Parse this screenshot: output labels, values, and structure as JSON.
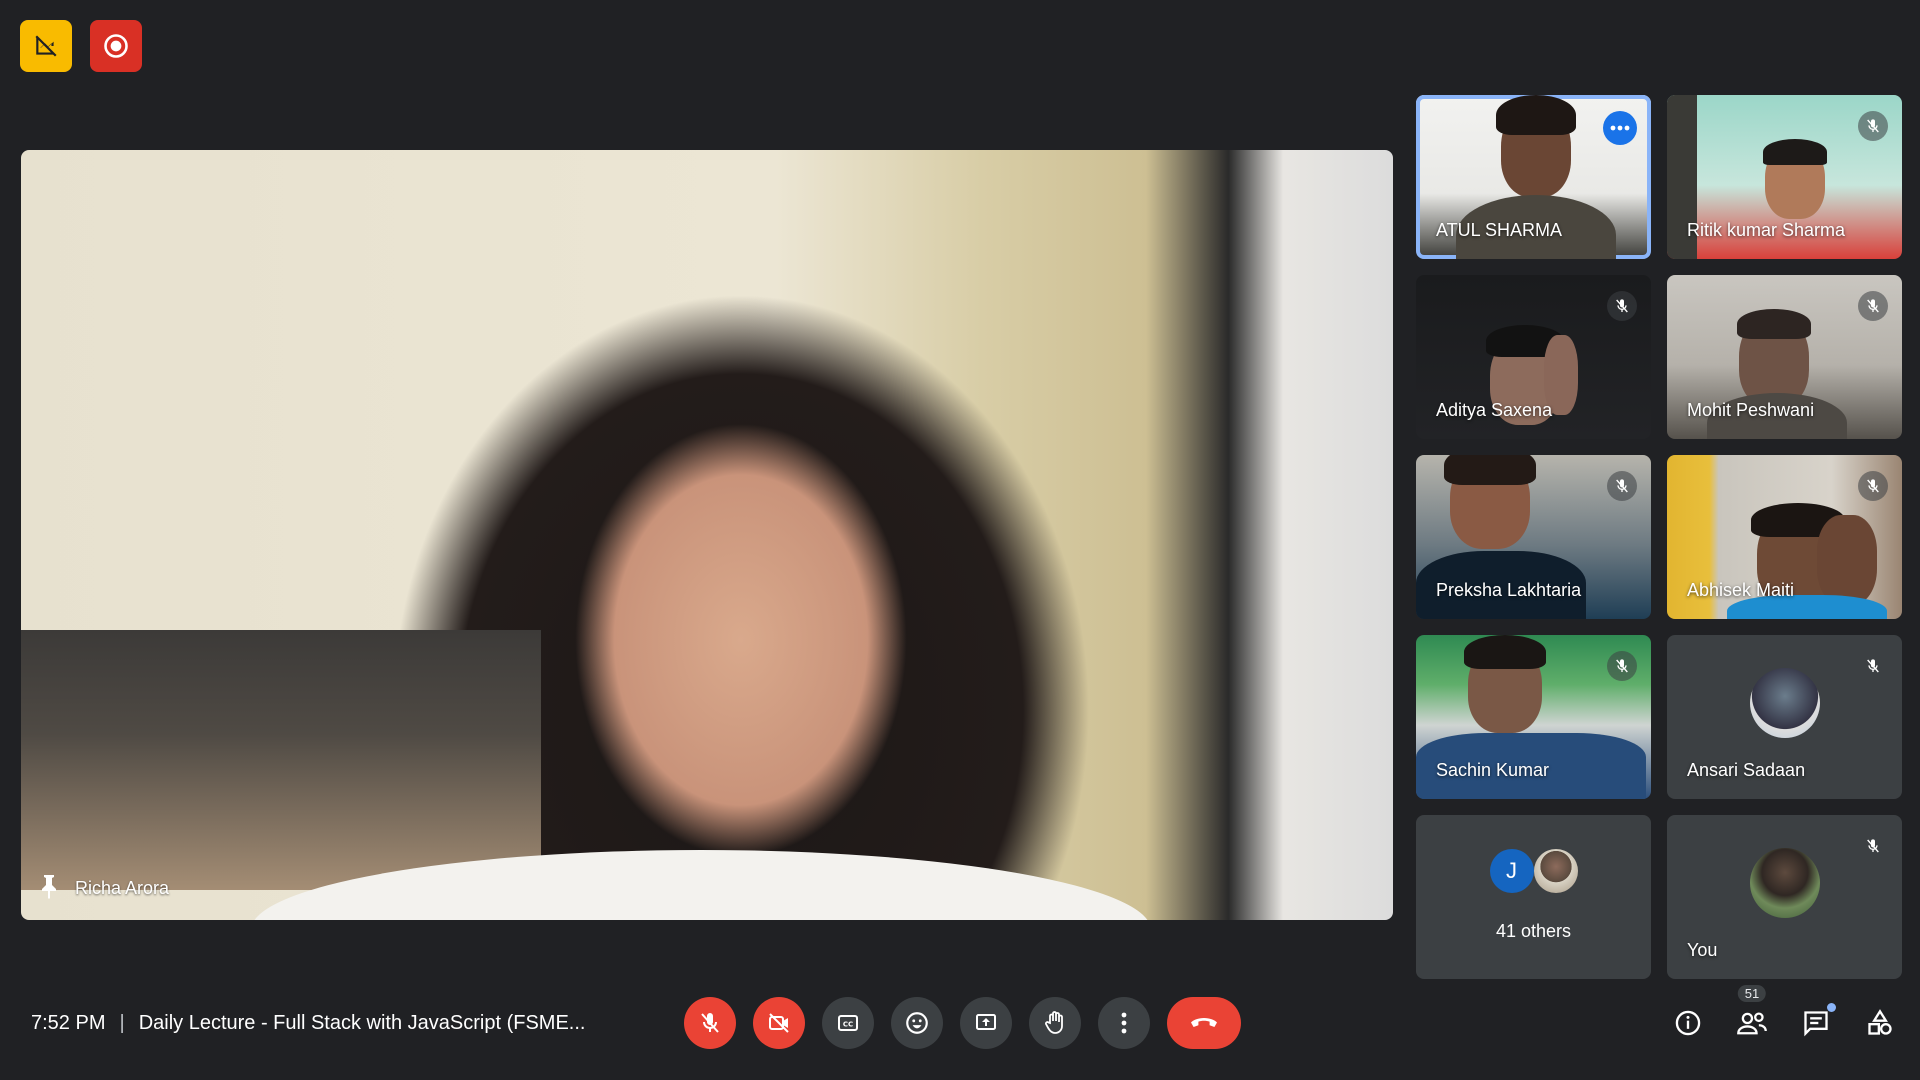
{
  "top": {
    "badges": [
      "data-saver-off-icon",
      "recording-icon"
    ],
    "colors": {
      "yellow": "#f9bb00",
      "red": "#d93025"
    }
  },
  "main_video": {
    "participant": "Richa Arora",
    "pinned": true
  },
  "participants": [
    {
      "name": "ATUL SHARMA",
      "speaking": true,
      "muted": false
    },
    {
      "name": "Ritik kumar Sharma",
      "muted": true
    },
    {
      "name": "Aditya Saxena",
      "muted": true
    },
    {
      "name": "Mohit Peshwani",
      "muted": true
    },
    {
      "name": "Preksha Lakhtaria",
      "muted": true
    },
    {
      "name": "Abhisek Maiti",
      "muted": true
    },
    {
      "name": "Sachin Kumar",
      "muted": true
    },
    {
      "name": "Ansari Sadaan",
      "muted": true
    }
  ],
  "others": {
    "initial": "J",
    "label": "41 others"
  },
  "self_tile": {
    "name": "You",
    "muted": true
  },
  "bottom_bar": {
    "time": "7:52 PM",
    "meeting_title": "Daily Lecture - Full Stack with JavaScript (FSME...",
    "participant_count": "51",
    "controls": [
      "mic-off-icon",
      "camera-off-icon",
      "captions-icon",
      "emoji-icon",
      "present-icon",
      "raise-hand-icon",
      "more-options-icon",
      "hang-up-icon"
    ],
    "right_controls": [
      "info-icon",
      "people-icon",
      "chat-icon",
      "activities-icon"
    ]
  },
  "colors": {
    "background": "#202124",
    "tile": "#3c4043",
    "danger": "#ea4335",
    "accent": "#8ab4f8",
    "speaking_blue": "#1a73e8"
  }
}
